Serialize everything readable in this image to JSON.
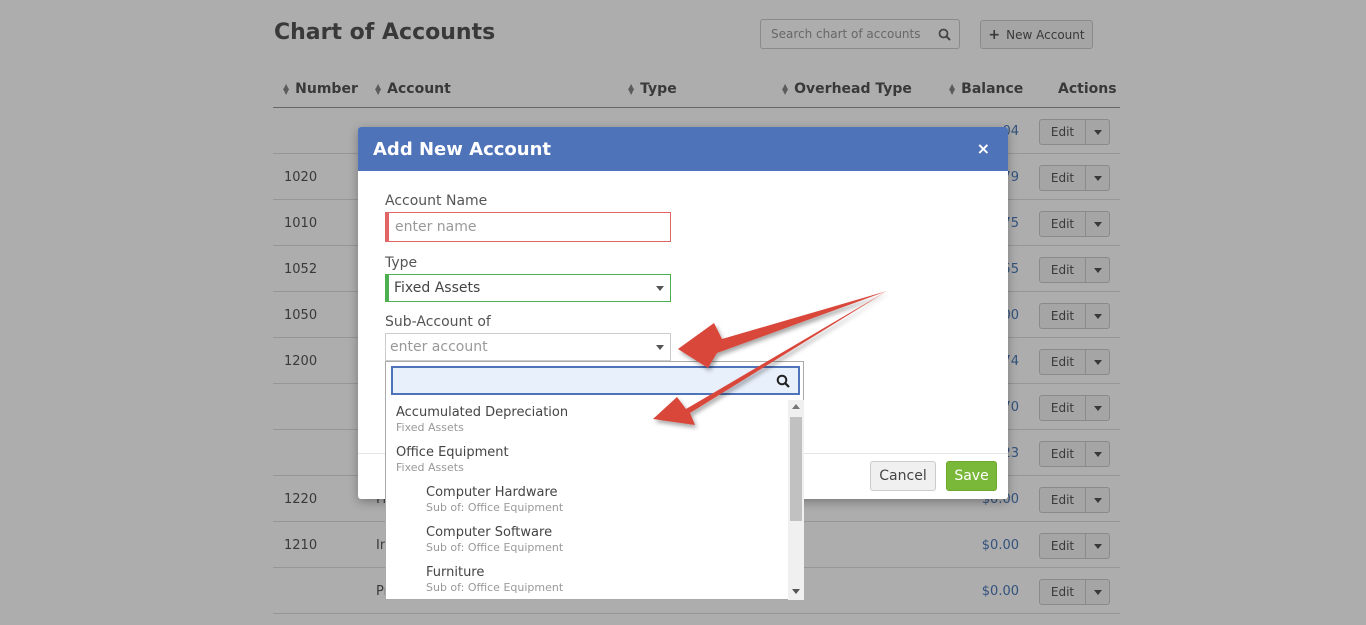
{
  "page": {
    "title": "Chart of Accounts",
    "search_placeholder": "Search chart of accounts",
    "new_account_label": "New Account"
  },
  "table": {
    "columns": [
      "Number",
      "Account",
      "Type",
      "Overhead Type",
      "Balance",
      "Actions"
    ],
    "rows": [
      {
        "number": "",
        "account": "",
        "balance": "04"
      },
      {
        "number": "1020",
        "account": "",
        "balance": "79"
      },
      {
        "number": "1010",
        "account": "",
        "balance": "75"
      },
      {
        "number": "1052",
        "account": "",
        "balance": "55"
      },
      {
        "number": "1050",
        "account": "",
        "balance": "00"
      },
      {
        "number": "1200",
        "account": "",
        "balance": "74"
      },
      {
        "number": "",
        "account": "",
        "balance": "70"
      },
      {
        "number": "",
        "account": "",
        "balance": "23"
      },
      {
        "number": "1220",
        "account": "Fi",
        "balance": "$0.00"
      },
      {
        "number": "1210",
        "account": "In",
        "balance": "$0.00"
      },
      {
        "number": "",
        "account": "Pr",
        "balance": "$0.00"
      }
    ],
    "edit_label": "Edit"
  },
  "modal": {
    "title": "Add New Account",
    "close_label": "×",
    "account_name_label": "Account Name",
    "account_name_placeholder": "enter name",
    "type_label": "Type",
    "type_value": "Fixed Assets",
    "sub_account_label": "Sub-Account of",
    "sub_account_placeholder": "enter account",
    "cancel_label": "Cancel",
    "save_label": "Save"
  },
  "dropdown": {
    "items": [
      {
        "name": "Accumulated Depreciation",
        "sub": "Fixed Assets",
        "indent": false
      },
      {
        "name": "Office Equipment",
        "sub": "Fixed Assets",
        "indent": false
      },
      {
        "name": "Computer Hardware",
        "sub": "Sub of: Office Equipment",
        "indent": true
      },
      {
        "name": "Computer Software",
        "sub": "Sub of: Office Equipment",
        "indent": true
      },
      {
        "name": "Furniture",
        "sub": "Sub of: Office Equipment",
        "indent": true
      }
    ]
  },
  "colors": {
    "modal_header": "#4f73b8",
    "save_button": "#7ab83a",
    "error_border": "#e06666",
    "valid_border": "#4caf50",
    "annotation_arrow": "#d9463a"
  },
  "icons": [
    "search-icon",
    "plus-icon",
    "close-icon",
    "chevron-down-icon",
    "sort-icon"
  ]
}
